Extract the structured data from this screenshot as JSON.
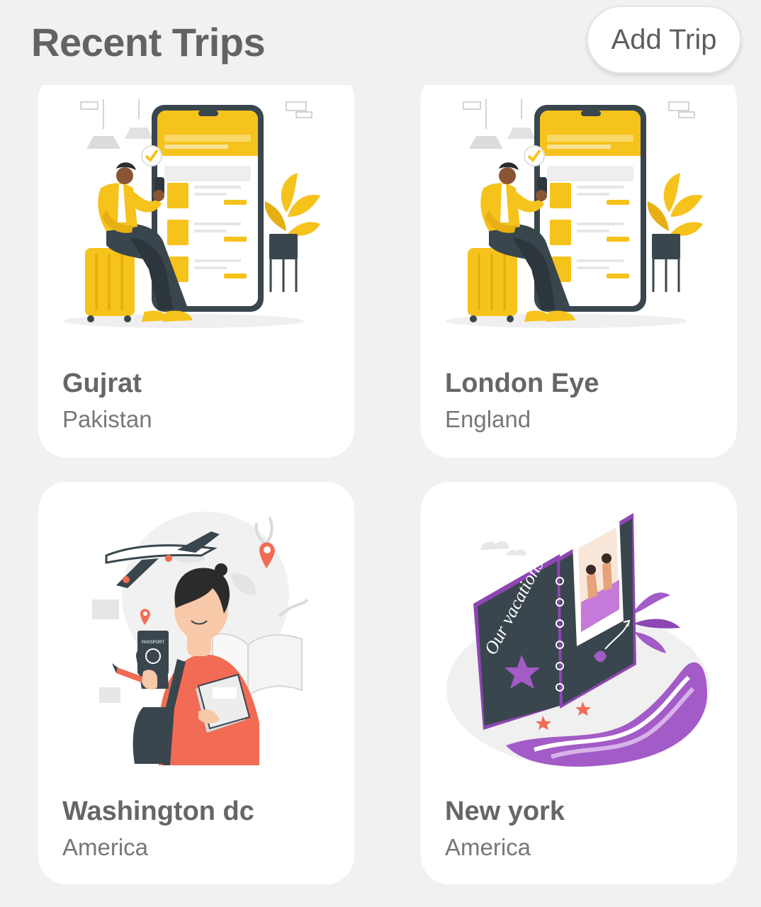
{
  "header": {
    "title": "Recent Trips",
    "add_button_label": "Add Trip"
  },
  "trips": [
    {
      "name": "Gujrat",
      "country": "Pakistan",
      "illustration": "traveler-booking-app-illustration"
    },
    {
      "name": "London Eye",
      "country": "England",
      "illustration": "traveler-booking-app-illustration"
    },
    {
      "name": "Washington dc",
      "country": "America",
      "illustration": "student-passport-travel-illustration"
    },
    {
      "name": "New york",
      "country": "America",
      "illustration": "vacation-photo-album-illustration"
    }
  ],
  "illustration_text": {
    "album_cover": "Our vacations",
    "passport_label": "PASSPORT"
  },
  "colors": {
    "background": "#f1f1f1",
    "card": "#ffffff",
    "title_text": "#636363",
    "accent_yellow": "#f6c21c",
    "accent_coral": "#f26b55",
    "accent_purple": "#a35bc7",
    "dark_slate": "#3a464d"
  }
}
